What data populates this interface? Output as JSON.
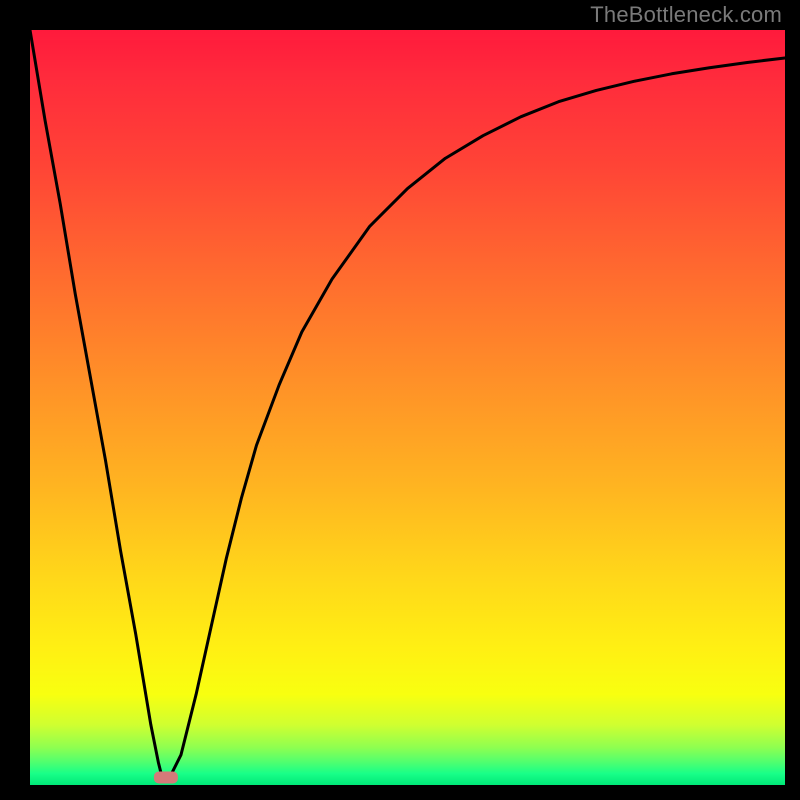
{
  "watermark": "TheBottleneck.com",
  "chart_data": {
    "type": "line",
    "title": "",
    "xlabel": "",
    "ylabel": "",
    "xlim": [
      0,
      100
    ],
    "ylim": [
      0,
      100
    ],
    "grid": false,
    "legend": false,
    "background_gradient": {
      "type": "vertical",
      "stops": [
        {
          "pos": 0.0,
          "color": "#ff1a3c"
        },
        {
          "pos": 0.18,
          "color": "#ff4436"
        },
        {
          "pos": 0.46,
          "color": "#ff8f28"
        },
        {
          "pos": 0.72,
          "color": "#ffd61a"
        },
        {
          "pos": 0.88,
          "color": "#f8ff10"
        },
        {
          "pos": 0.97,
          "color": "#4fff70"
        },
        {
          "pos": 1.0,
          "color": "#00e878"
        }
      ]
    },
    "series": [
      {
        "name": "bottleneck-curve",
        "x": [
          0,
          2,
          4,
          6,
          8,
          10,
          12,
          14,
          16,
          17,
          17.5,
          18.5,
          20,
          22,
          24,
          26,
          28,
          30,
          33,
          36,
          40,
          45,
          50,
          55,
          60,
          65,
          70,
          75,
          80,
          85,
          90,
          95,
          100
        ],
        "values": [
          100,
          88,
          77,
          65,
          54,
          43,
          31,
          20,
          8,
          3,
          1,
          1,
          4,
          12,
          21,
          30,
          38,
          45,
          53,
          60,
          67,
          74,
          79,
          83,
          86,
          88.5,
          90.5,
          92,
          93.2,
          94.2,
          95,
          95.7,
          96.3
        ]
      }
    ],
    "marker": {
      "name": "optimal-point",
      "x": 18,
      "y": 1,
      "shape": "rounded-rect",
      "color": "#d47a79"
    }
  }
}
